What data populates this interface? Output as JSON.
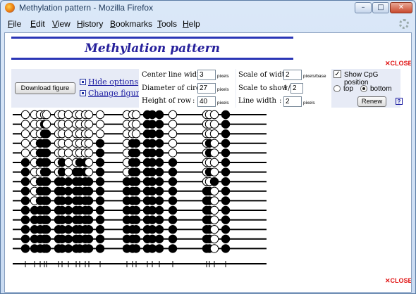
{
  "window": {
    "title": "Methylation pattern - Mozilla Firefox"
  },
  "menu": [
    "File",
    "Edit",
    "View",
    "History",
    "Bookmarks",
    "Tools",
    "Help"
  ],
  "page": {
    "title": "Methylation pattern",
    "close_label": "CLOSE"
  },
  "controls": {
    "download_label": "Download figure",
    "hide_options_label": "Hide options",
    "change_figure_label": "Change figure",
    "center_line_width": {
      "label": "Center line width :",
      "value": "3",
      "unit": "pixels"
    },
    "diameter_of_circle": {
      "label": "Diameter of circle :",
      "value": "27",
      "unit": "pixels"
    },
    "height_of_row": {
      "label": "Height of row",
      "colon": ":",
      "value": "40",
      "unit": "pixels"
    },
    "scale_of_width": {
      "label": "Scale of width :",
      "value": "2",
      "unit": "pixels/base"
    },
    "scale_to_show": {
      "label": "Scale to show :",
      "prefix": "1/",
      "value": "2"
    },
    "line_width": {
      "label": "Line width",
      "colon": ":",
      "value": "2",
      "unit": "pixels"
    },
    "show_cpg_label": "Show CpG position",
    "show_cpg_checked": true,
    "position_top_label": "top",
    "position_bottom_label": "bottom",
    "position_selected": "bottom",
    "renew_label": "Renew",
    "help_label": "?"
  },
  "methylation": {
    "cpg_positions": [
      18,
      31,
      39,
      45,
      48,
      65,
      70,
      79,
      90,
      95,
      103,
      108,
      124,
      162,
      170,
      175,
      191,
      198,
      208,
      227,
      275,
      279,
      286,
      302
    ],
    "rows": [
      "0000000000000000111000010",
      "0001000000000000111000010",
      "0001100000000000111000010",
      "0011100000001011111001010",
      "0011100000001011111001010",
      "1011101001101011111100010",
      "1001101011101011111101010",
      "1011111111111111111100110",
      "1011111111111111111111011",
      "1011111111111111111111011",
      "1111111111111111111111011",
      "1111111111111111111111011",
      "1111111111111111111111011",
      "1111111111111111111111011",
      "1111111111111111111111011"
    ]
  }
}
